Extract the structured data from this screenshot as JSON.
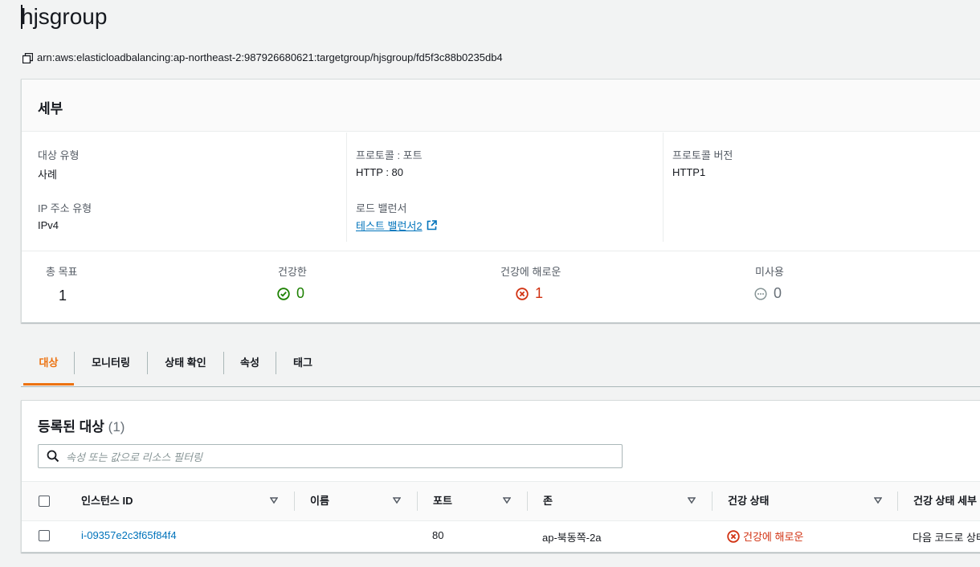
{
  "header": {
    "title": "hjsgroup",
    "arn": "arn:aws:elasticloadbalancing:ap-northeast-2:987926680621:targetgroup/hjsgroup/fd5f3c88b0235db4"
  },
  "details": {
    "title": "세부",
    "target_type_label": "대상 유형",
    "target_type_value": "사례",
    "ip_type_label": "IP 주소 유형",
    "ip_type_value": "IPv4",
    "protocol_port_label": "프로토콜 : 포트",
    "protocol_port_value": "HTTP : 80",
    "load_balancer_label": "로드 밸런서",
    "load_balancer_value": "테스트 밸런서2",
    "protocol_version_label": "프로토콜 버전",
    "protocol_version_value": "HTTP1"
  },
  "stats": {
    "total_label": "총 목표",
    "total_value": "1",
    "healthy_label": "건강한",
    "healthy_value": "0",
    "unhealthy_label": "건강에 해로운",
    "unhealthy_value": "1",
    "unused_label": "미사용",
    "unused_value": "0"
  },
  "tabs": [
    {
      "label": "대상",
      "active": true
    },
    {
      "label": "모니터링",
      "active": false
    },
    {
      "label": "상태 확인",
      "active": false
    },
    {
      "label": "속성",
      "active": false
    },
    {
      "label": "태그",
      "active": false
    }
  ],
  "targets": {
    "title": "등록된 대상",
    "count": "(1)",
    "search_placeholder": "속성 또는 값으로 리소스 필터링",
    "columns": [
      "인스턴스 ID",
      "이름",
      "포트",
      "존",
      "건강 상태",
      "건강 상태 세부"
    ],
    "rows": [
      {
        "instance_id": "i-09357e2c3f65f84f4",
        "name": "",
        "port": "80",
        "zone": "ap-북동쪽-2a",
        "health": "건강에 해로운",
        "health_detail": "다음 코드로 상태"
      }
    ]
  },
  "colors": {
    "accent": "#ec7211",
    "link": "#0073bb",
    "healthy": "#1d8102",
    "unhealthy": "#d13212",
    "unused": "#687078"
  },
  "icons": {
    "copy": "copy-icon",
    "external_link": "external-link-icon",
    "healthy": "check-circle-icon",
    "unhealthy": "x-circle-icon",
    "unused": "ellipsis-circle-icon",
    "search": "search-icon",
    "sort": "caret-down-icon"
  }
}
